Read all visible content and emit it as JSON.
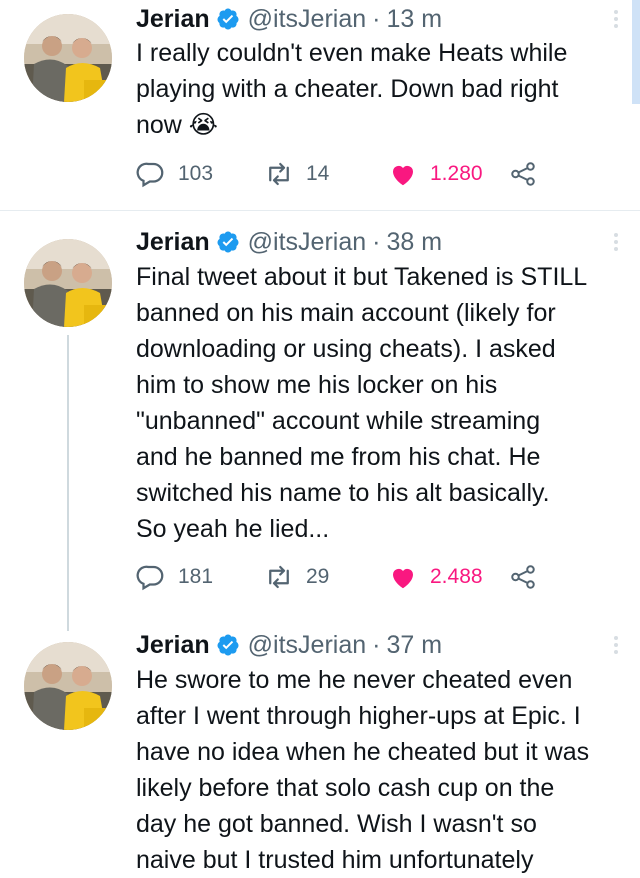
{
  "colors": {
    "verified": "#1d9bf0",
    "like_active": "#f91880",
    "muted": "#536471",
    "text": "#0f1419"
  },
  "icons": {
    "verified": "verified-badge-icon",
    "reply": "reply-icon",
    "retweet": "retweet-icon",
    "like": "heart-filled-icon",
    "share": "share-icon",
    "more": "more-dots-icon"
  },
  "tweets": [
    {
      "name": "Jerian",
      "handle": "@itsJerian",
      "time": "13 m",
      "lines": [
        "I really couldn't even make Heats while",
        "playing with a cheater. Down bad right",
        "now 😭"
      ],
      "replies": "103",
      "retweets": "14",
      "likes": "1.280"
    },
    {
      "name": "Jerian",
      "handle": "@itsJerian",
      "time": "38 m",
      "lines": [
        "Final tweet about it but Takened is STILL",
        "banned on his main account (likely for",
        "downloading or using cheats). I asked",
        "him to show me his locker on his",
        "\"unbanned\" account while streaming",
        "and he banned me from his chat. He",
        "switched his name to his alt basically.",
        "So yeah he lied..."
      ],
      "replies": "181",
      "retweets": "29",
      "likes": "2.488"
    },
    {
      "name": "Jerian",
      "handle": "@itsJerian",
      "time": "37 m",
      "lines": [
        "He swore to me he never cheated even",
        "after I went through higher-ups at Epic. I",
        "have no idea when he cheated but it was",
        "likely before that solo cash cup on the",
        "day he got banned. Wish I wasn't so",
        "naive but I trusted him unfortunately"
      ]
    }
  ]
}
